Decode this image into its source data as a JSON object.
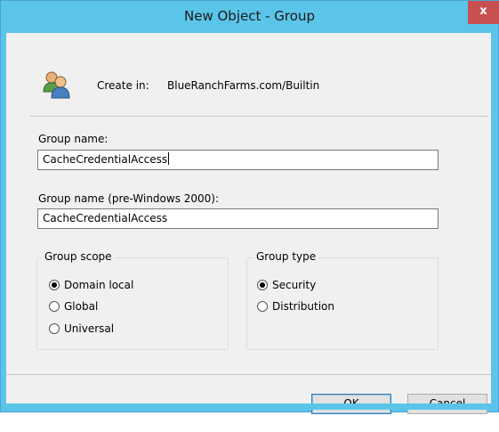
{
  "window": {
    "title": "New Object - Group",
    "close_label": "x"
  },
  "create_in": {
    "label": "Create in:",
    "value": "BlueRanchFarms.com/Builtin"
  },
  "group_name": {
    "label": "Group name:",
    "value": "CacheCredentialAccess"
  },
  "group_name_pre2000": {
    "label": "Group name (pre-Windows 2000):",
    "value": "CacheCredentialAccess"
  },
  "group_scope": {
    "legend": "Group scope",
    "options": [
      {
        "label": "Domain local",
        "selected": true
      },
      {
        "label": "Global",
        "selected": false
      },
      {
        "label": "Universal",
        "selected": false
      }
    ]
  },
  "group_type": {
    "legend": "Group type",
    "options": [
      {
        "label": "Security",
        "selected": true
      },
      {
        "label": "Distribution",
        "selected": false
      }
    ]
  },
  "buttons": {
    "ok": "OK",
    "cancel": "Cancel"
  },
  "colors": {
    "titlebar": "#5bc5e9",
    "close": "#c75050",
    "client": "#f0f0f0"
  },
  "icons": {
    "object": "users-group-icon"
  }
}
